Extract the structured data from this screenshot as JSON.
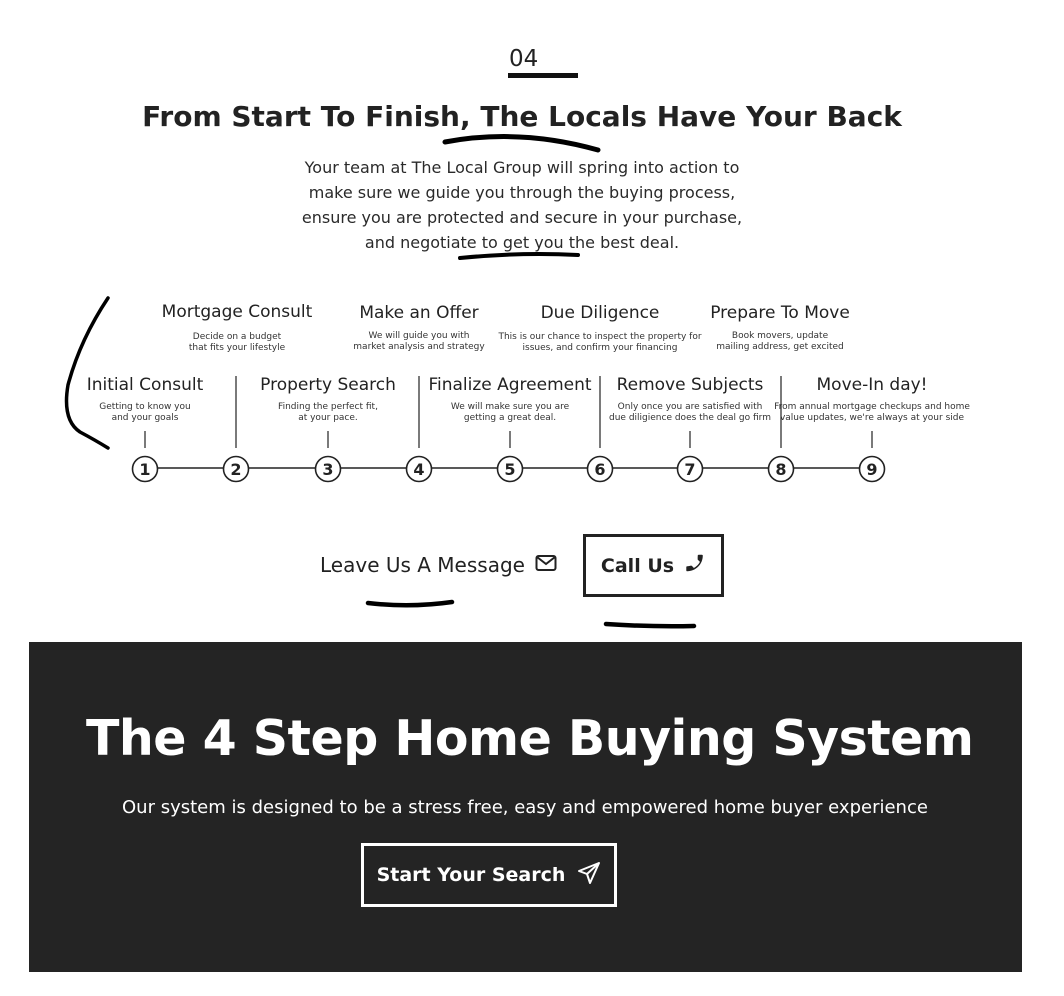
{
  "section": {
    "number": "04",
    "title": "From Start To Finish, The Locals Have Your Back",
    "intro_lines": [
      "Your team at The Local Group will spring into action to",
      "make sure we guide you through the buying process,",
      "ensure you are protected and secure in your purchase,",
      "and negotiate to get you the best deal."
    ]
  },
  "timeline": {
    "lower_steps": [
      {
        "number": "1",
        "title": "Initial Consult",
        "desc": "Getting to know you\nand your goals"
      },
      {
        "number": "3",
        "title": "Property Search",
        "desc": "Finding the perfect fit,\nat your pace."
      },
      {
        "number": "5",
        "title": "Finalize Agreement",
        "desc": "We will make sure you are\ngetting a great deal."
      },
      {
        "number": "7",
        "title": "Remove Subjects",
        "desc": "Only once you are satisfied with\ndue diligience does the deal go firm"
      },
      {
        "number": "9",
        "title": "Move-In day!",
        "desc": "From annual mortgage checkups and home\nvalue updates, we're always at your side"
      }
    ],
    "upper_steps": [
      {
        "number": "2",
        "title": "Mortgage Consult",
        "desc": "Decide on a budget\nthat fits your lifestyle"
      },
      {
        "number": "4",
        "title": "Make an Offer",
        "desc": "We will guide you with\nmarket analysis and strategy"
      },
      {
        "number": "6",
        "title": "Due Diligence",
        "desc": "This is our chance to inspect the property for\nissues, and confirm your financing"
      },
      {
        "number": "8",
        "title": "Prepare To Move",
        "desc": "Book movers, update\nmailing address, get excited"
      }
    ]
  },
  "cta": {
    "message_label": "Leave Us A Message",
    "message_icon": "envelope-icon",
    "call_label": "Call Us",
    "call_icon": "phone-icon"
  },
  "system": {
    "title": "The 4 Step Home Buying System",
    "subtitle": "Our system is designed to be a stress free, easy and empowered home buyer experience",
    "button_label": "Start Your Search",
    "button_icon": "paper-plane-icon",
    "background": "#242424"
  }
}
